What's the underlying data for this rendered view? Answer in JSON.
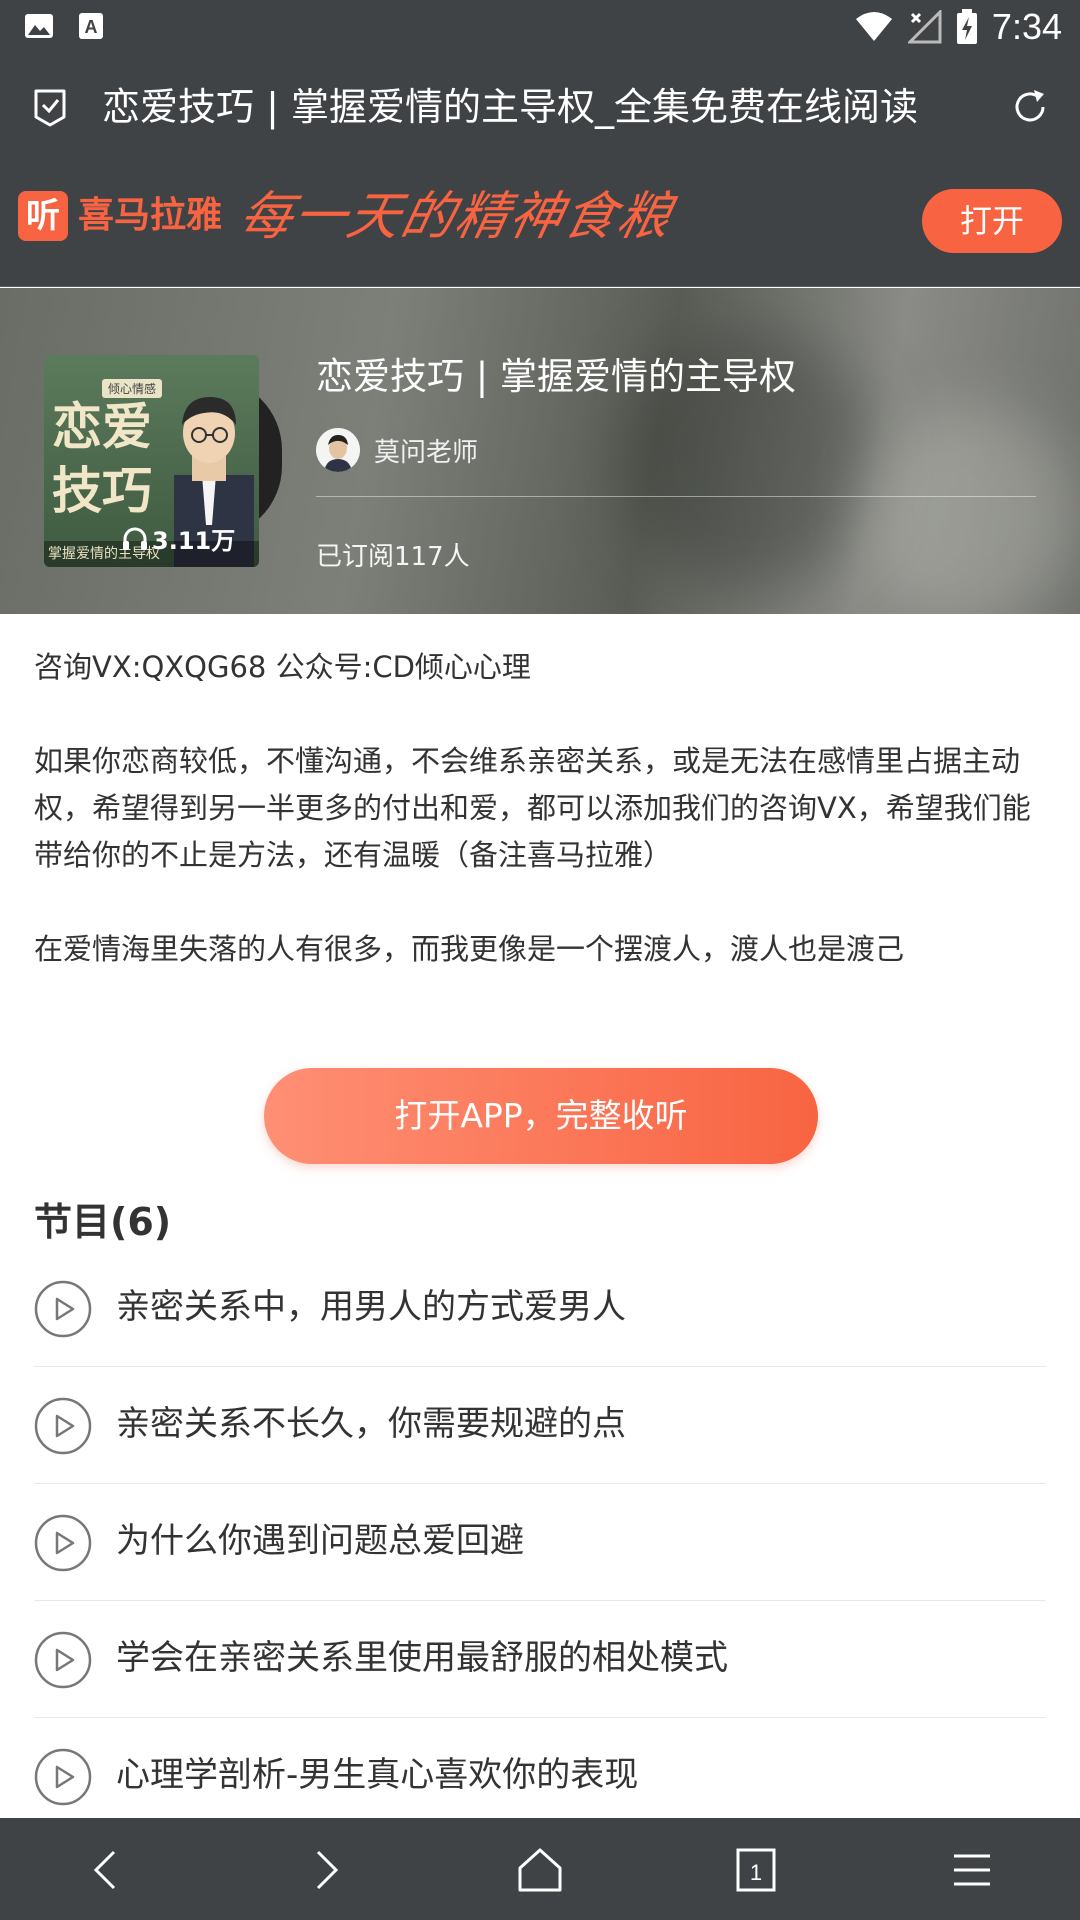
{
  "status_bar": {
    "time": "7:34",
    "icons": [
      "image-icon",
      "font-download-icon",
      "wifi-icon",
      "no-signal-icon",
      "battery-charging-icon"
    ]
  },
  "toolbar": {
    "page_title": "恋爱技巧 | 掌握爱情的主导权_全集免费在线阅读"
  },
  "app_banner": {
    "logo_glyph": "听",
    "logo_text": "喜马拉雅",
    "slogan": "每一天的精神食粮",
    "open_label": "打开",
    "brand_color": "#f86442"
  },
  "album": {
    "cover": {
      "tag": "倾心情感",
      "title": "恋爱技巧",
      "subtitle": "掌握爱情的主导权",
      "plays": "3.11万"
    },
    "title": "恋爱技巧 | 掌握爱情的主导权",
    "author": "莫问老师",
    "subscribed": "已订阅117人"
  },
  "description": {
    "line1": "咨询VX:QXQG68 公众号:CD倾心心理",
    "para2": "如果你恋商较低，不懂沟通，不会维系亲密关系，或是无法在感情里占据主动权，希望得到另一半更多的付出和爱，都可以添加我们的咨询VX，希望我们能带给你的不止是方法，还有温暖（备注喜马拉雅）",
    "para3": "在爱情海里失落的人有很多，而我更像是一个摆渡人，渡人也是渡己"
  },
  "cta": {
    "label": "打开APP，完整收听"
  },
  "episodes": {
    "header": "节目(6)",
    "items": [
      {
        "title": "亲密关系中，用男人的方式爱男人"
      },
      {
        "title": "亲密关系不长久，你需要规避的点"
      },
      {
        "title": "为什么你遇到问题总爱回避"
      },
      {
        "title": "学会在亲密关系里使用最舒服的相处模式"
      },
      {
        "title": "心理学剖析-男生真心喜欢你的表现"
      }
    ]
  },
  "bottom_nav": {
    "tab_count": "1",
    "icons": [
      "back-icon",
      "forward-icon",
      "home-icon",
      "tabs-icon",
      "menu-icon"
    ]
  }
}
